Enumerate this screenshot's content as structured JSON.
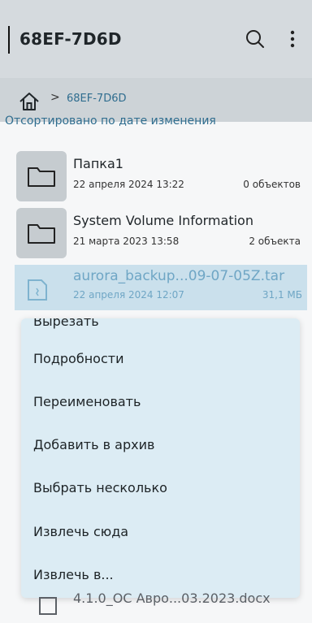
{
  "header": {
    "title": "68EF-7D6D"
  },
  "breadcrumb": {
    "current": "68EF-7D6D",
    "separator": ">"
  },
  "sort_label": "Отсортировано по дате изменения",
  "items": [
    {
      "name": "Папка1",
      "date": "22 апреля 2024 13:22",
      "count": "0 объектов",
      "icon": "folder-icon"
    },
    {
      "name": "System Volume Information",
      "date": "21 марта 2023 13:58",
      "count": "2 объекта",
      "icon": "folder-icon"
    },
    {
      "name": "aurora_backup...09-07-05Z.tar",
      "date": "22 апреля 2024 12:07",
      "count": "31,1 МБ",
      "icon": "archive-file-icon"
    }
  ],
  "context_menu": {
    "items": [
      "Вырезать",
      "Подробности",
      "Переименовать",
      "Добавить в архив",
      "Выбрать несколько",
      "Извлечь сюда",
      "Извлечь в..."
    ]
  },
  "bottom_item": {
    "name": "4.1.0_ОС Авро...03.2023.docx"
  },
  "colors": {
    "accent": "#2f6d8f",
    "menu_bg": "#dcecf4",
    "selected_bg": "#bfd9e6"
  }
}
